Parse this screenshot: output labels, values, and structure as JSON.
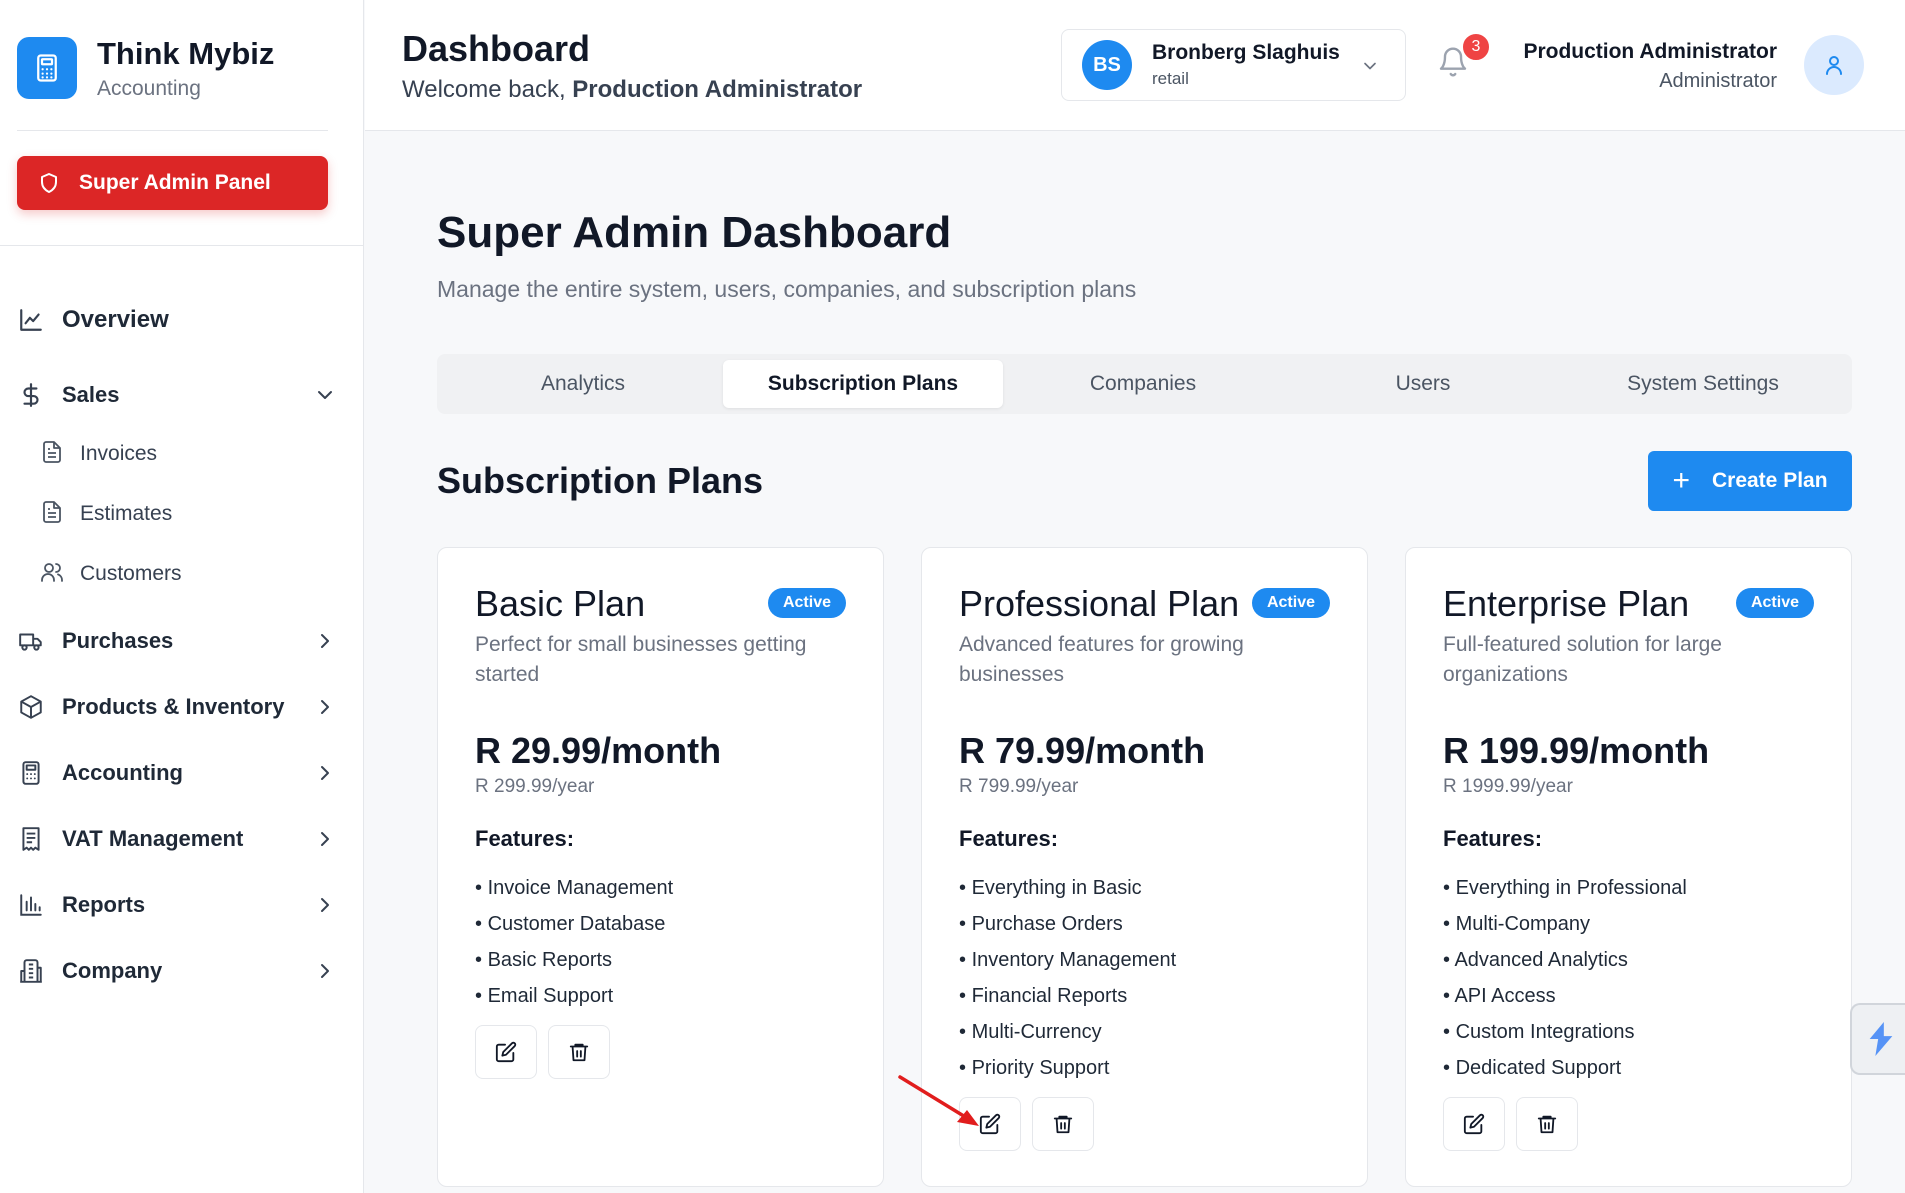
{
  "brand": {
    "name": "Think Mybiz",
    "subtitle": "Accounting",
    "icon": "calculator-icon"
  },
  "super_admin_label": "Super Admin Panel",
  "sidebar": {
    "overview": "Overview",
    "sales": "Sales",
    "sales_sub": [
      "Invoices",
      "Estimates",
      "Customers"
    ],
    "items": [
      "Purchases",
      "Products & Inventory",
      "Accounting",
      "VAT Management",
      "Reports",
      "Company"
    ]
  },
  "header": {
    "title": "Dashboard",
    "welcome_prefix": "Welcome back,",
    "welcome_user": "Production Administrator",
    "company": {
      "initials": "BS",
      "name": "Bronberg Slaghuis",
      "type": "retail"
    },
    "notifications": "3",
    "user_name": "Production Administrator",
    "user_role": "Administrator"
  },
  "main": {
    "title": "Super Admin Dashboard",
    "subtitle": "Manage the entire system, users, companies, and subscription plans",
    "tabs": [
      "Analytics",
      "Subscription Plans",
      "Companies",
      "Users",
      "System Settings"
    ],
    "active_tab": "Subscription Plans",
    "section_title": "Subscription Plans",
    "create_label": "Create Plan"
  },
  "plans": [
    {
      "name": "Basic Plan",
      "status": "Active",
      "description": "Perfect for small businesses getting started",
      "price": "R 29.99/month",
      "yearly": "R 299.99/year",
      "features_heading": "Features:",
      "features": [
        "Invoice Management",
        "Customer Database",
        "Basic Reports",
        "Email Support"
      ]
    },
    {
      "name": "Professional Plan",
      "status": "Active",
      "description": "Advanced features for growing businesses",
      "price": "R 79.99/month",
      "yearly": "R 799.99/year",
      "features_heading": "Features:",
      "features": [
        "Everything in Basic",
        "Purchase Orders",
        "Inventory Management",
        "Financial Reports",
        "Multi-Currency",
        "Priority Support"
      ]
    },
    {
      "name": "Enterprise Plan",
      "status": "Active",
      "description": "Full-featured solution for large organizations",
      "price": "R 199.99/month",
      "yearly": "R 1999.99/year",
      "features_heading": "Features:",
      "features": [
        "Everything in Professional",
        "Multi-Company",
        "Advanced Analytics",
        "API Access",
        "Custom Integrations",
        "Dedicated Support"
      ]
    }
  ],
  "colors": {
    "accent": "#1e8af0",
    "danger": "#dc2626",
    "badge": "#ef4444"
  }
}
